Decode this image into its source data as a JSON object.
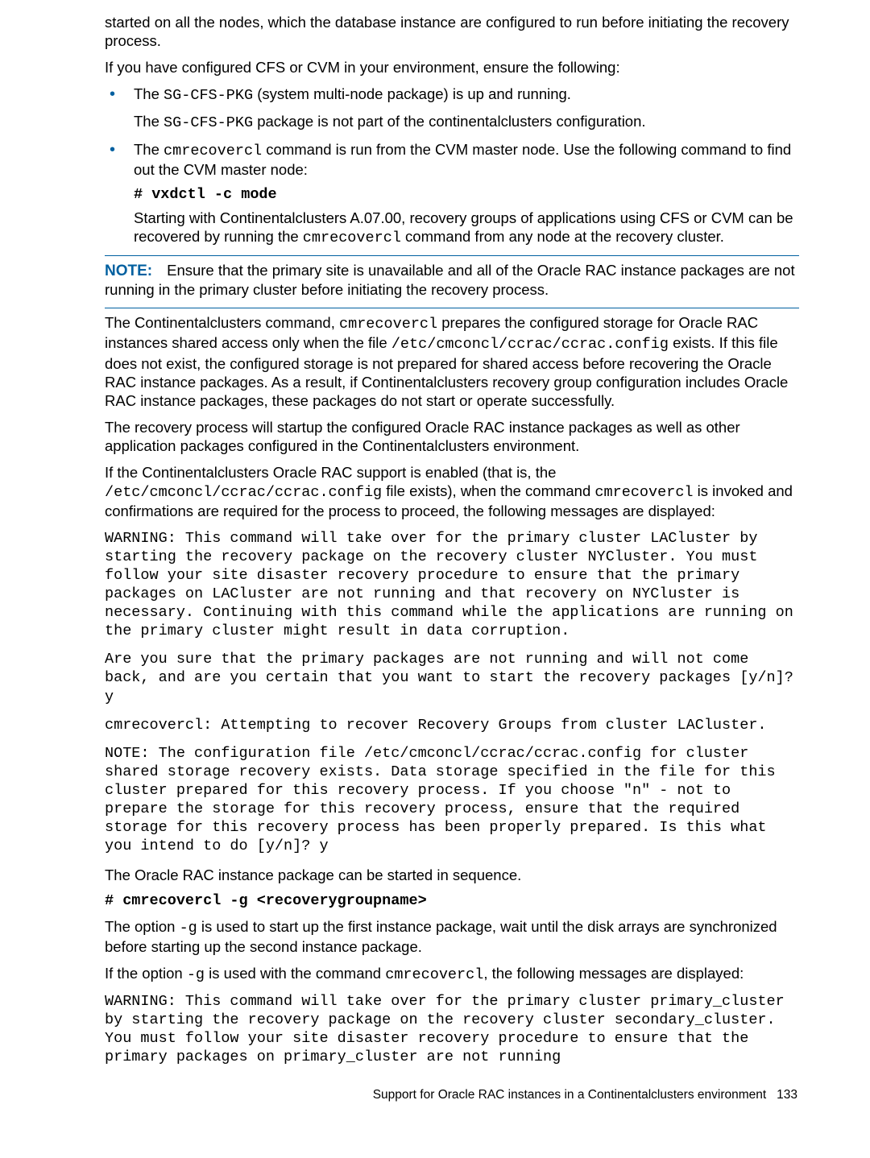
{
  "intro": {
    "p1": "started on all the nodes, which the database instance are configured to run before initiating the recovery process.",
    "p2": "If you have configured CFS or CVM in your environment, ensure the following:"
  },
  "bullet1": {
    "pre": "The ",
    "code": "SG-CFS-PKG",
    "post": " (system multi-node package) is up and running.",
    "line2_pre": "The ",
    "line2_code": "SG-CFS-PKG",
    "line2_post": " package is not part of the continentalclusters configuration."
  },
  "bullet2": {
    "pre": "The ",
    "code": "cmrecovercl",
    "post": " command is run from the CVM master node. Use the following command to find out the CVM master node:",
    "cmd": "# vxdctl -c mode",
    "after_pre": "Starting with Continentalclusters A.07.00, recovery groups of applications using CFS or CVM can be recovered by running the ",
    "after_code": "cmrecovercl",
    "after_post": " command from any node at the recovery cluster."
  },
  "note": {
    "label": "NOTE:",
    "text": "Ensure that the primary site is unavailable and all of the Oracle RAC instance packages are not running in the primary cluster before initiating the recovery process."
  },
  "body": {
    "p1_a": "The Continentalclusters command, ",
    "p1_code1": "cmrecovercl",
    "p1_b": " prepares the configured storage for Oracle RAC instances shared access only when the file ",
    "p1_code2": "/etc/cmconcl/ccrac/ccrac.config",
    "p1_c": " exists. If this file does not exist, the configured storage is not prepared for shared access before recovering the Oracle RAC instance packages. As a result, if Continentalclusters recovery group configuration includes Oracle RAC instance packages, these packages do not start or operate successfully.",
    "p2": "The recovery process will startup the configured Oracle RAC instance packages as well as other application packages configured in the Continentalclusters environment.",
    "p3_a": "If the Continentalclusters Oracle RAC support is enabled (that is, the ",
    "p3_code1": "/etc/cmconcl/ccrac/ccrac.config",
    "p3_b": " file exists), when the command ",
    "p3_code2": "cmrecovercl",
    "p3_c": " is invoked and confirmations are required for the process to proceed, the following messages are displayed:"
  },
  "out1": "WARNING: This command will take over for the primary cluster LACluster by starting the recovery package on the recovery cluster NYCluster. You must follow your site disaster recovery procedure to ensure that the primary packages on LACluster are not running and that recovery on NYCluster is necessary. Continuing with this command while the applications are running on the primary cluster might result in data corruption.",
  "out2": "Are you sure that the primary packages are not running and will not come back, and are you certain that you want to start the recovery packages [y/n]? y",
  "out3": "cmrecovercl: Attempting to recover Recovery Groups from cluster LACluster.",
  "out4": "NOTE: The configuration file /etc/cmconcl/ccrac/ccrac.config for cluster shared storage recovery exists. Data storage specified in the file for this cluster prepared for this recovery process. If you choose \"n\" - not to prepare the storage for this recovery process, ensure that the required storage for this recovery process has been properly prepared. Is this what you intend to do [y/n]? y",
  "seq_line": "The Oracle RAC instance package can be started in sequence.",
  "cmd2": "# cmrecovercl -g <recoverygroupname>",
  "opt_g": {
    "a": "The option ",
    "code": "-g",
    "b": " is used to start up the first instance package, wait until the disk arrays are synchronized before starting up the second instance package."
  },
  "if_g": {
    "a": "If the option ",
    "code1": "-g",
    "b": " is used with the command ",
    "code2": "cmrecovercl",
    "c": ", the following messages are displayed:"
  },
  "out5": "WARNING: This command will take over for the primary cluster primary_cluster by starting the recovery package on the recovery cluster secondary_cluster. You must follow your site disaster recovery procedure to ensure that the primary packages on primary_cluster are not running",
  "footer": {
    "text": "Support for Oracle RAC instances in a Continentalclusters environment",
    "page": "133"
  }
}
